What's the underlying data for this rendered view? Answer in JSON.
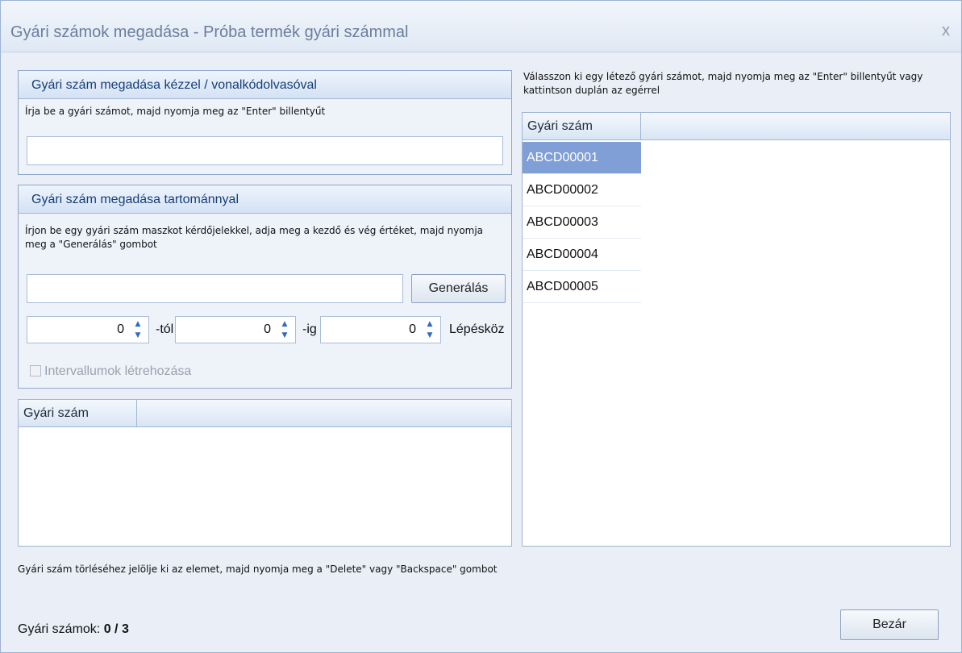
{
  "window": {
    "title": "Gyári számok megadása - Próba termék gyári számmal",
    "close_glyph": "x"
  },
  "manual_group": {
    "header": "Gyári szám megadása kézzel / vonalkódolvasóval",
    "hint": "Írja be a gyári számot, majd nyomja meg az \"Enter\" billentyűt",
    "input_value": ""
  },
  "range_group": {
    "header": "Gyári szám megadása tartománnyal",
    "hint": "Írjon be egy gyári szám maszkot kérdőjelekkel, adja meg a kezdő és vég értéket, majd nyomja meg a \"Generálás\" gombot",
    "mask_value": "",
    "generate_label": "Generálás",
    "from_value": "0",
    "from_label": "-tól",
    "to_value": "0",
    "to_label": "-ig",
    "step_value": "0",
    "step_label": "Lépésköz",
    "intervals_label": "Intervallumok létrehozása"
  },
  "selected_grid": {
    "column": "Gyári szám",
    "rows": []
  },
  "available": {
    "hint": "Válasszon ki egy létező gyári számot, majd nyomja meg az \"Enter\" billentyűt vagy kattintson duplán az egérrel",
    "column": "Gyári szám",
    "rows": [
      "ABCD00001",
      "ABCD00002",
      "ABCD00003",
      "ABCD00004",
      "ABCD00005"
    ],
    "selected_index": 0
  },
  "footer": {
    "delete_hint": "Gyári szám törléséhez jelölje ki az elemet, majd nyomja meg a \"Delete\" vagy \"Backspace\" gombot",
    "count_label": "Gyári számok:",
    "count_value": "0 / 3",
    "close_button": "Bezár"
  },
  "colors": {
    "accent": "#163e78",
    "selection": "#7f9fd6",
    "border": "#8fa7ca"
  },
  "icons": {
    "close": "close-icon",
    "spin": "spin-arrows-icon",
    "checkbox": "checkbox-icon"
  }
}
